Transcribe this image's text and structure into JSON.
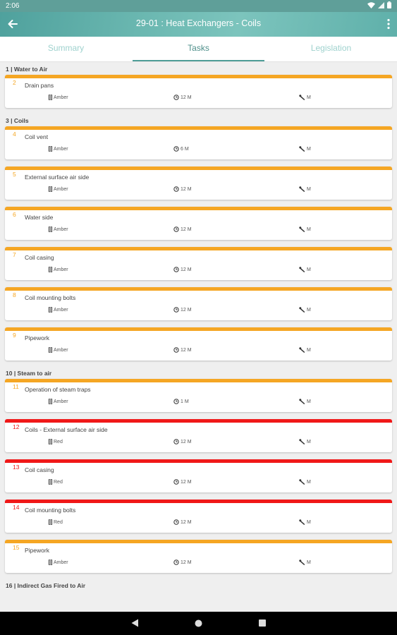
{
  "status_bar": {
    "time": "2:06"
  },
  "header": {
    "title": "29-01 : Heat Exchangers - Coils"
  },
  "tabs": [
    {
      "label": "Summary",
      "active": false
    },
    {
      "label": "Tasks",
      "active": true
    },
    {
      "label": "Legislation",
      "active": false
    }
  ],
  "colors": {
    "amber": "#f5a623",
    "red": "#f01818",
    "accent": "#4e9d97"
  },
  "sections": [
    {
      "title": "1 | Water to Air",
      "tasks": [
        {
          "num": "2",
          "name": "Drain pans",
          "rating": "Amber",
          "interval": "12 M",
          "type": "M",
          "color": "amber"
        }
      ]
    },
    {
      "title": "3 | Coils",
      "tasks": [
        {
          "num": "4",
          "name": "Coil vent",
          "rating": "Amber",
          "interval": "6 M",
          "type": "M",
          "color": "amber"
        },
        {
          "num": "5",
          "name": "External surface air side",
          "rating": "Amber",
          "interval": "12 M",
          "type": "M",
          "color": "amber"
        },
        {
          "num": "6",
          "name": "Water side",
          "rating": "Amber",
          "interval": "12 M",
          "type": "M",
          "color": "amber"
        },
        {
          "num": "7",
          "name": "Coil casing",
          "rating": "Amber",
          "interval": "12 M",
          "type": "M",
          "color": "amber"
        },
        {
          "num": "8",
          "name": "Coil mounting bolts",
          "rating": "Amber",
          "interval": "12 M",
          "type": "M",
          "color": "amber"
        },
        {
          "num": "9",
          "name": "Pipework",
          "rating": "Amber",
          "interval": "12 M",
          "type": "M",
          "color": "amber"
        }
      ]
    },
    {
      "title": "10 | Steam to air",
      "tasks": [
        {
          "num": "11",
          "name": "Operation of steam traps",
          "rating": "Amber",
          "interval": "1 M",
          "type": "M",
          "color": "amber"
        },
        {
          "num": "12",
          "name": "Coils - External surface air side",
          "rating": "Red",
          "interval": "12 M",
          "type": "M",
          "color": "red"
        },
        {
          "num": "13",
          "name": "Coil casing",
          "rating": "Red",
          "interval": "12 M",
          "type": "M",
          "color": "red"
        },
        {
          "num": "14",
          "name": "Coil mounting bolts",
          "rating": "Red",
          "interval": "12 M",
          "type": "M",
          "color": "red"
        },
        {
          "num": "15",
          "name": "Pipework",
          "rating": "Amber",
          "interval": "12 M",
          "type": "M",
          "color": "amber"
        }
      ]
    },
    {
      "title": "16 | Indirect Gas Fired to Air",
      "tasks": []
    }
  ],
  "icons": {
    "back": "arrow-left-icon",
    "menu": "more-vert-icon",
    "rating": "traffic-light-icon",
    "interval": "history-clock-icon",
    "type": "wrench-icon"
  }
}
